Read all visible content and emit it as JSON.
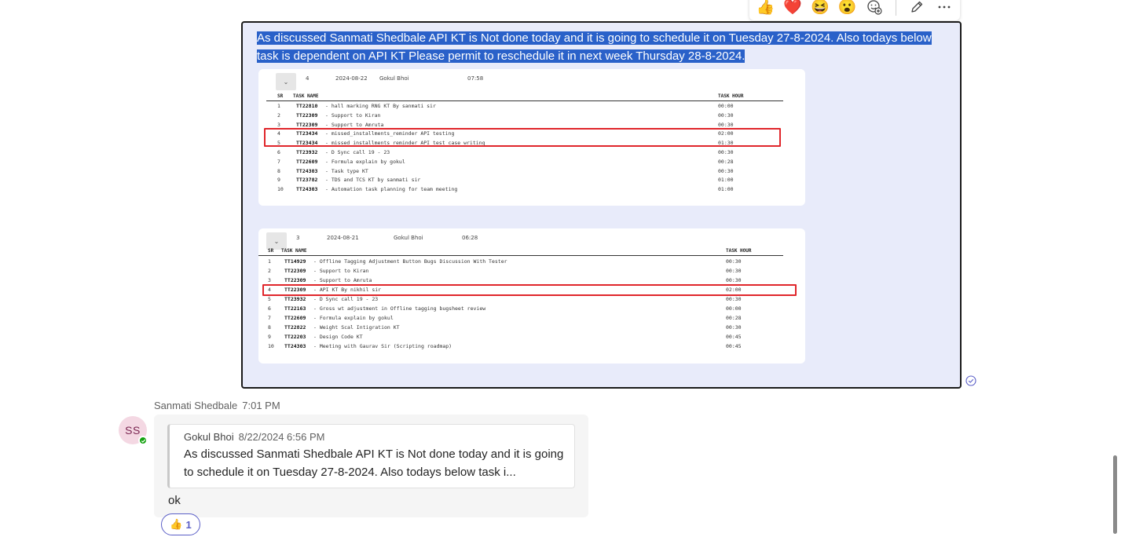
{
  "toolbar": {
    "reactions": [
      {
        "name": "like",
        "glyph": "👍"
      },
      {
        "name": "heart",
        "glyph": "❤️"
      },
      {
        "name": "laugh",
        "glyph": "😆"
      },
      {
        "name": "surprised",
        "glyph": "😮"
      }
    ],
    "icons": [
      "add-reaction-icon",
      "edit-icon",
      "more-options-icon"
    ]
  },
  "selected_message": {
    "text": "As discussed Sanmati Shedbale API KT is Not done today and it is going to schedule it on Tuesday 27-8-2024. Also todays below task is dependent on API KT Please permit to reschedule it in next week Thursday 28-8-2024.",
    "card1": {
      "chevron": "⌄",
      "count": "4",
      "date": "2024-08-22",
      "user": "Gokul Bhoi",
      "total": "07:58",
      "col_sr": "SR",
      "col_task": "TASK NAME",
      "col_hour": "TASK HOUR",
      "rows": [
        {
          "sr": "1",
          "code": "TT22810",
          "desc": "- hall marking RNG KT By sanmati sir",
          "hour": "00:00"
        },
        {
          "sr": "2",
          "code": "TT22309",
          "desc": "- Support to Kiran",
          "hour": "00:30"
        },
        {
          "sr": "3",
          "code": "TT22309",
          "desc": "- Support to Amruta",
          "hour": "00:30"
        },
        {
          "sr": "4",
          "code": "TT23434",
          "desc": "- missed_installments_reminder API testing",
          "hour": "02:00"
        },
        {
          "sr": "5",
          "code": "TT23434",
          "desc": "- missed_installments_reminder API test case writing",
          "hour": "01:30"
        },
        {
          "sr": "6",
          "code": "TT23932",
          "desc": "- D Sync call 19 - 23",
          "hour": "00:30"
        },
        {
          "sr": "7",
          "code": "TT22609",
          "desc": "- Formula explain by gokul",
          "hour": "00:28"
        },
        {
          "sr": "8",
          "code": "TT24303",
          "desc": "- Task type  KT",
          "hour": "00:30"
        },
        {
          "sr": "9",
          "code": "TT23782",
          "desc": "- TDS and TCS KT by sanmati sir",
          "hour": "01:00"
        },
        {
          "sr": "10",
          "code": "TT24303",
          "desc": "- Automation task planning for team meeting",
          "hour": "01:00"
        }
      ]
    },
    "card2": {
      "chevron": "⌄",
      "count": "3",
      "date": "2024-08-21",
      "user": "Gokul Bhoi",
      "total": "06:28",
      "col_sr": "SR",
      "col_task": "TASK NAME",
      "col_hour": "TASK HOUR",
      "rows": [
        {
          "sr": "1",
          "code": "TT14929",
          "desc": "- Offline Tagging Adjustment Button Bugs Discussion With Tester",
          "hour": "00:30"
        },
        {
          "sr": "2",
          "code": "TT22309",
          "desc": "- Support to Kiran",
          "hour": "00:30"
        },
        {
          "sr": "3",
          "code": "TT22309",
          "desc": "- Support to Amruta",
          "hour": "00:30"
        },
        {
          "sr": "4",
          "code": "TT22309",
          "desc": "- API KT By nikhil sir",
          "hour": "02:00"
        },
        {
          "sr": "5",
          "code": "TT23932",
          "desc": "- D Sync call 19 - 23",
          "hour": "00:30"
        },
        {
          "sr": "6",
          "code": "TT22163",
          "desc": "- Gross wt adjustment in Offline tagging bugsheet review",
          "hour": "00:00"
        },
        {
          "sr": "7",
          "code": "TT22609",
          "desc": "- Formula explain by gokul",
          "hour": "00:28"
        },
        {
          "sr": "8",
          "code": "TT22822",
          "desc": "- Weight Scal Intigration KT",
          "hour": "00:30"
        },
        {
          "sr": "9",
          "code": "TT22203",
          "desc": "- Design Code KT",
          "hour": "00:45"
        },
        {
          "sr": "10",
          "code": "TT24303",
          "desc": "- Meeting with Gaurav Sir (Scripting roadmap)",
          "hour": "00:45"
        }
      ]
    }
  },
  "reply": {
    "sender": "Sanmati Shedbale",
    "time": "7:01 PM",
    "avatar_initials": "SS",
    "quote_author": "Gokul Bhoi",
    "quote_time": "8/22/2024 6:56 PM",
    "quote_text": "As discussed Sanmati Shedbale API KT is Not done today and it is going to schedule it on Tuesday 27-8-2024. Also todays below task i...",
    "text": "ok",
    "reaction_glyph": "👍",
    "reaction_count": "1"
  },
  "colors": {
    "selection": "#2a61c9",
    "bubble": "#e8ebfa",
    "highlight_box": "#e0262b",
    "accent": "#5b5fc7",
    "presence": "#13a10e"
  }
}
